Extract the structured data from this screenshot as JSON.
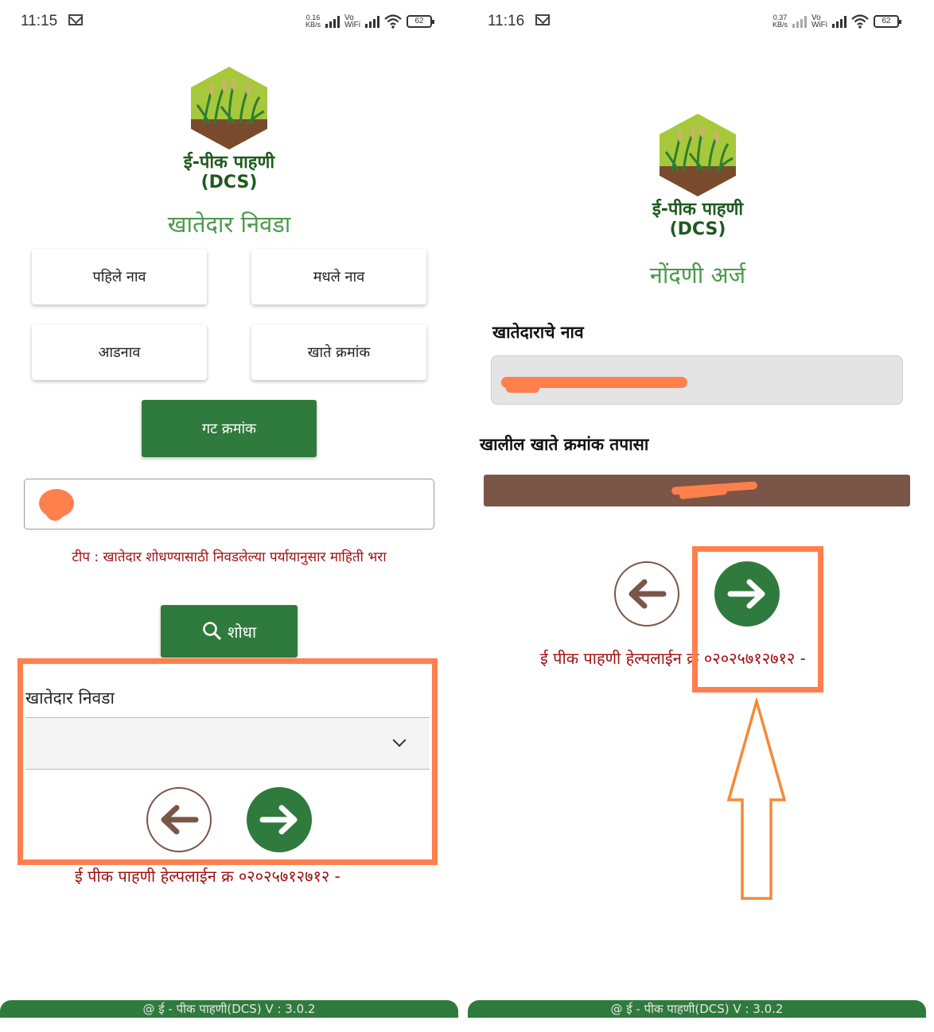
{
  "left": {
    "status": {
      "time": "11:15",
      "speed": "0.16\nKB/s",
      "vo": "Vo\nWiFi",
      "battery": "62"
    },
    "app_name": "ई-पीक पाहणी",
    "app_sub": "(DCS)",
    "title": "खातेदार निवडा",
    "options": [
      "पहिले नाव",
      "मधले नाव",
      "आडनाव",
      "खाते क्रमांक",
      "गट क्रमांक"
    ],
    "tip": "टीप : खातेदार शोधण्यासाठी निवडलेल्या पर्यायानुसार माहिती भरा",
    "search_label": "शोधा",
    "select_label": "खातेदार निवडा",
    "helpline": "ई पीक पाहणी हेल्पलाईन क्र ०२०२५७१२७१२ -",
    "footer": "@ ई - पीक पाहणी(DCS) V : 3.0.2"
  },
  "right": {
    "status": {
      "time": "11:16",
      "speed": "0.37\nKB/s",
      "vo": "Vo\nWiFi",
      "battery": "62"
    },
    "app_name": "ई-पीक पाहणी",
    "app_sub": "(DCS)",
    "title": "नोंदणी अर्ज",
    "name_label": "खातेदाराचे नाव",
    "account_label": "खालील खाते क्रमांक तपासा",
    "helpline": "ई पीक पाहणी हेल्पलाई",
    "helpline_tail": "न क्र ०२०२५७१२७१२ -",
    "footer": "@ ई - पीक पाहणी(DCS) V : 3.0.2"
  },
  "colors": {
    "primary": "#2f7a3d",
    "brown": "#7b5547",
    "highlight": "#ff7f4d",
    "error": "#a01010"
  }
}
